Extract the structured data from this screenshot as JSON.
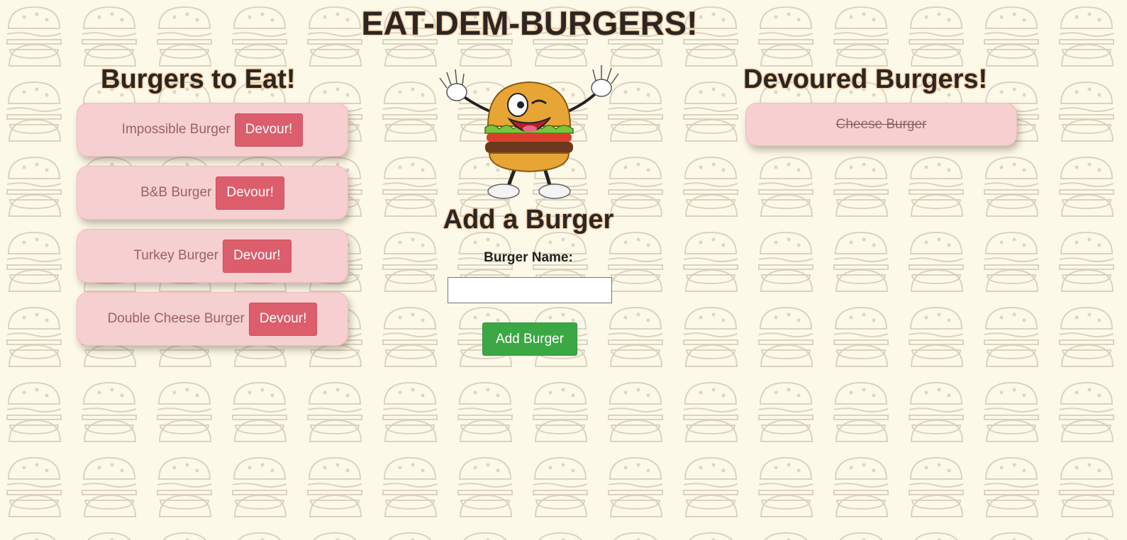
{
  "page": {
    "title": "EAT-DEM-BURGERS!"
  },
  "to_eat": {
    "title": "Burgers to Eat!",
    "items": [
      {
        "name": "Impossible Burger",
        "button": "Devour!"
      },
      {
        "name": "B&B Burger",
        "button": "Devour!"
      },
      {
        "name": "Turkey Burger",
        "button": "Devour!"
      },
      {
        "name": "Double Cheese Burger",
        "button": "Devour!"
      }
    ]
  },
  "devoured": {
    "title": "Devoured Burgers!",
    "items": [
      {
        "name": "Cheese Burger"
      }
    ]
  },
  "add_form": {
    "title": "Add a Burger",
    "label": "Burger Name:",
    "input_value": "",
    "input_placeholder": "",
    "button": "Add Burger"
  },
  "mascot": {
    "icon": "burger-mascot-icon"
  },
  "colors": {
    "background": "#fcf9e9",
    "card": "#f6cfd1",
    "devour_button": "#dc5e6c",
    "add_button": "#3ca845"
  }
}
